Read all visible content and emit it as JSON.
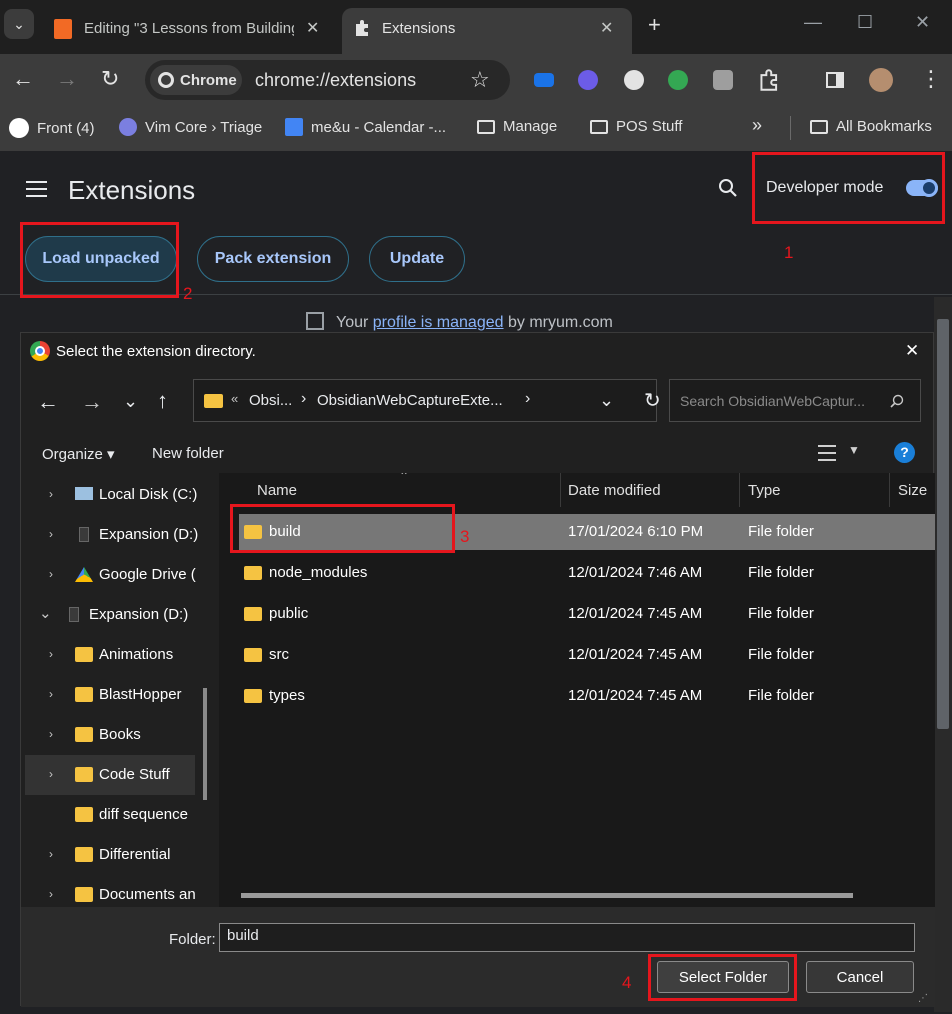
{
  "tabs": [
    {
      "title": "Editing \"3 Lessons from Building",
      "close": "✕"
    },
    {
      "title": "Extensions",
      "close": "✕"
    }
  ],
  "new_tab": "+",
  "window_controls": {
    "minimize": "—",
    "maximize": "☐",
    "close": "✕"
  },
  "toolbar": {
    "chip_label": "Chrome",
    "url": "chrome://extensions"
  },
  "bookmarks": [
    {
      "label": "Front (4)",
      "icon": "front-app-icon"
    },
    {
      "label": "Vim Core › Triage",
      "icon": "linear-icon"
    },
    {
      "label": "me&u - Calendar -...",
      "icon": "calendar-icon"
    },
    {
      "label": "Manage",
      "icon": "folder-icon"
    },
    {
      "label": "POS Stuff",
      "icon": "folder-icon"
    },
    {
      "label": "»",
      "icon": "overflow-icon"
    },
    {
      "label": "All Bookmarks",
      "icon": "folder-icon"
    }
  ],
  "extensions_page": {
    "title": "Extensions",
    "developer_mode_label": "Developer mode",
    "developer_mode_on": true,
    "buttons": {
      "load_unpacked": "Load unpacked",
      "pack_extension": "Pack extension",
      "update": "Update"
    },
    "managed_prefix": "Your",
    "managed_link": "profile is managed",
    "managed_suffix": "by mryum.com"
  },
  "annotations": {
    "n1": "1",
    "n2": "2",
    "n3": "3",
    "n4": "4"
  },
  "dialog": {
    "title": "Select the extension directory.",
    "close": "✕",
    "breadcrumb": {
      "prefix": "«",
      "crumb1": "Obsi...",
      "crumb2": "ObsidianWebCaptureExte...",
      "chevron": "›"
    },
    "search_placeholder": "Search ObsidianWebCaptur...",
    "organize": "Organize ▾",
    "new_folder": "New folder",
    "help": "?",
    "nav_items": [
      {
        "label": "Local Disk (C:)",
        "chevron": "›"
      },
      {
        "label": "Expansion (D:)",
        "chevron": "›"
      },
      {
        "label": "Google Drive (",
        "chevron": "›"
      },
      {
        "label": "Expansion (D:)",
        "chevron": "⌄"
      },
      {
        "label": "Animations",
        "chevron": "›"
      },
      {
        "label": "BlastHopper",
        "chevron": "›"
      },
      {
        "label": "Books",
        "chevron": "›"
      },
      {
        "label": "Code Stuff",
        "chevron": "›"
      },
      {
        "label": "diff sequence",
        "chevron": ""
      },
      {
        "label": "Differential",
        "chevron": "›"
      },
      {
        "label": "Documents an",
        "chevron": "›"
      }
    ],
    "columns": {
      "name": "Name",
      "date": "Date modified",
      "type": "Type",
      "size": "Size"
    },
    "files": [
      {
        "name": "build",
        "date": "17/01/2024 6:10 PM",
        "type": "File folder"
      },
      {
        "name": "node_modules",
        "date": "12/01/2024 7:46 AM",
        "type": "File folder"
      },
      {
        "name": "public",
        "date": "12/01/2024 7:45 AM",
        "type": "File folder"
      },
      {
        "name": "src",
        "date": "12/01/2024 7:45 AM",
        "type": "File folder"
      },
      {
        "name": "types",
        "date": "12/01/2024 7:45 AM",
        "type": "File folder"
      }
    ],
    "folder_label": "Folder:",
    "folder_value": "build",
    "select_button": "Select Folder",
    "cancel_button": "Cancel"
  }
}
